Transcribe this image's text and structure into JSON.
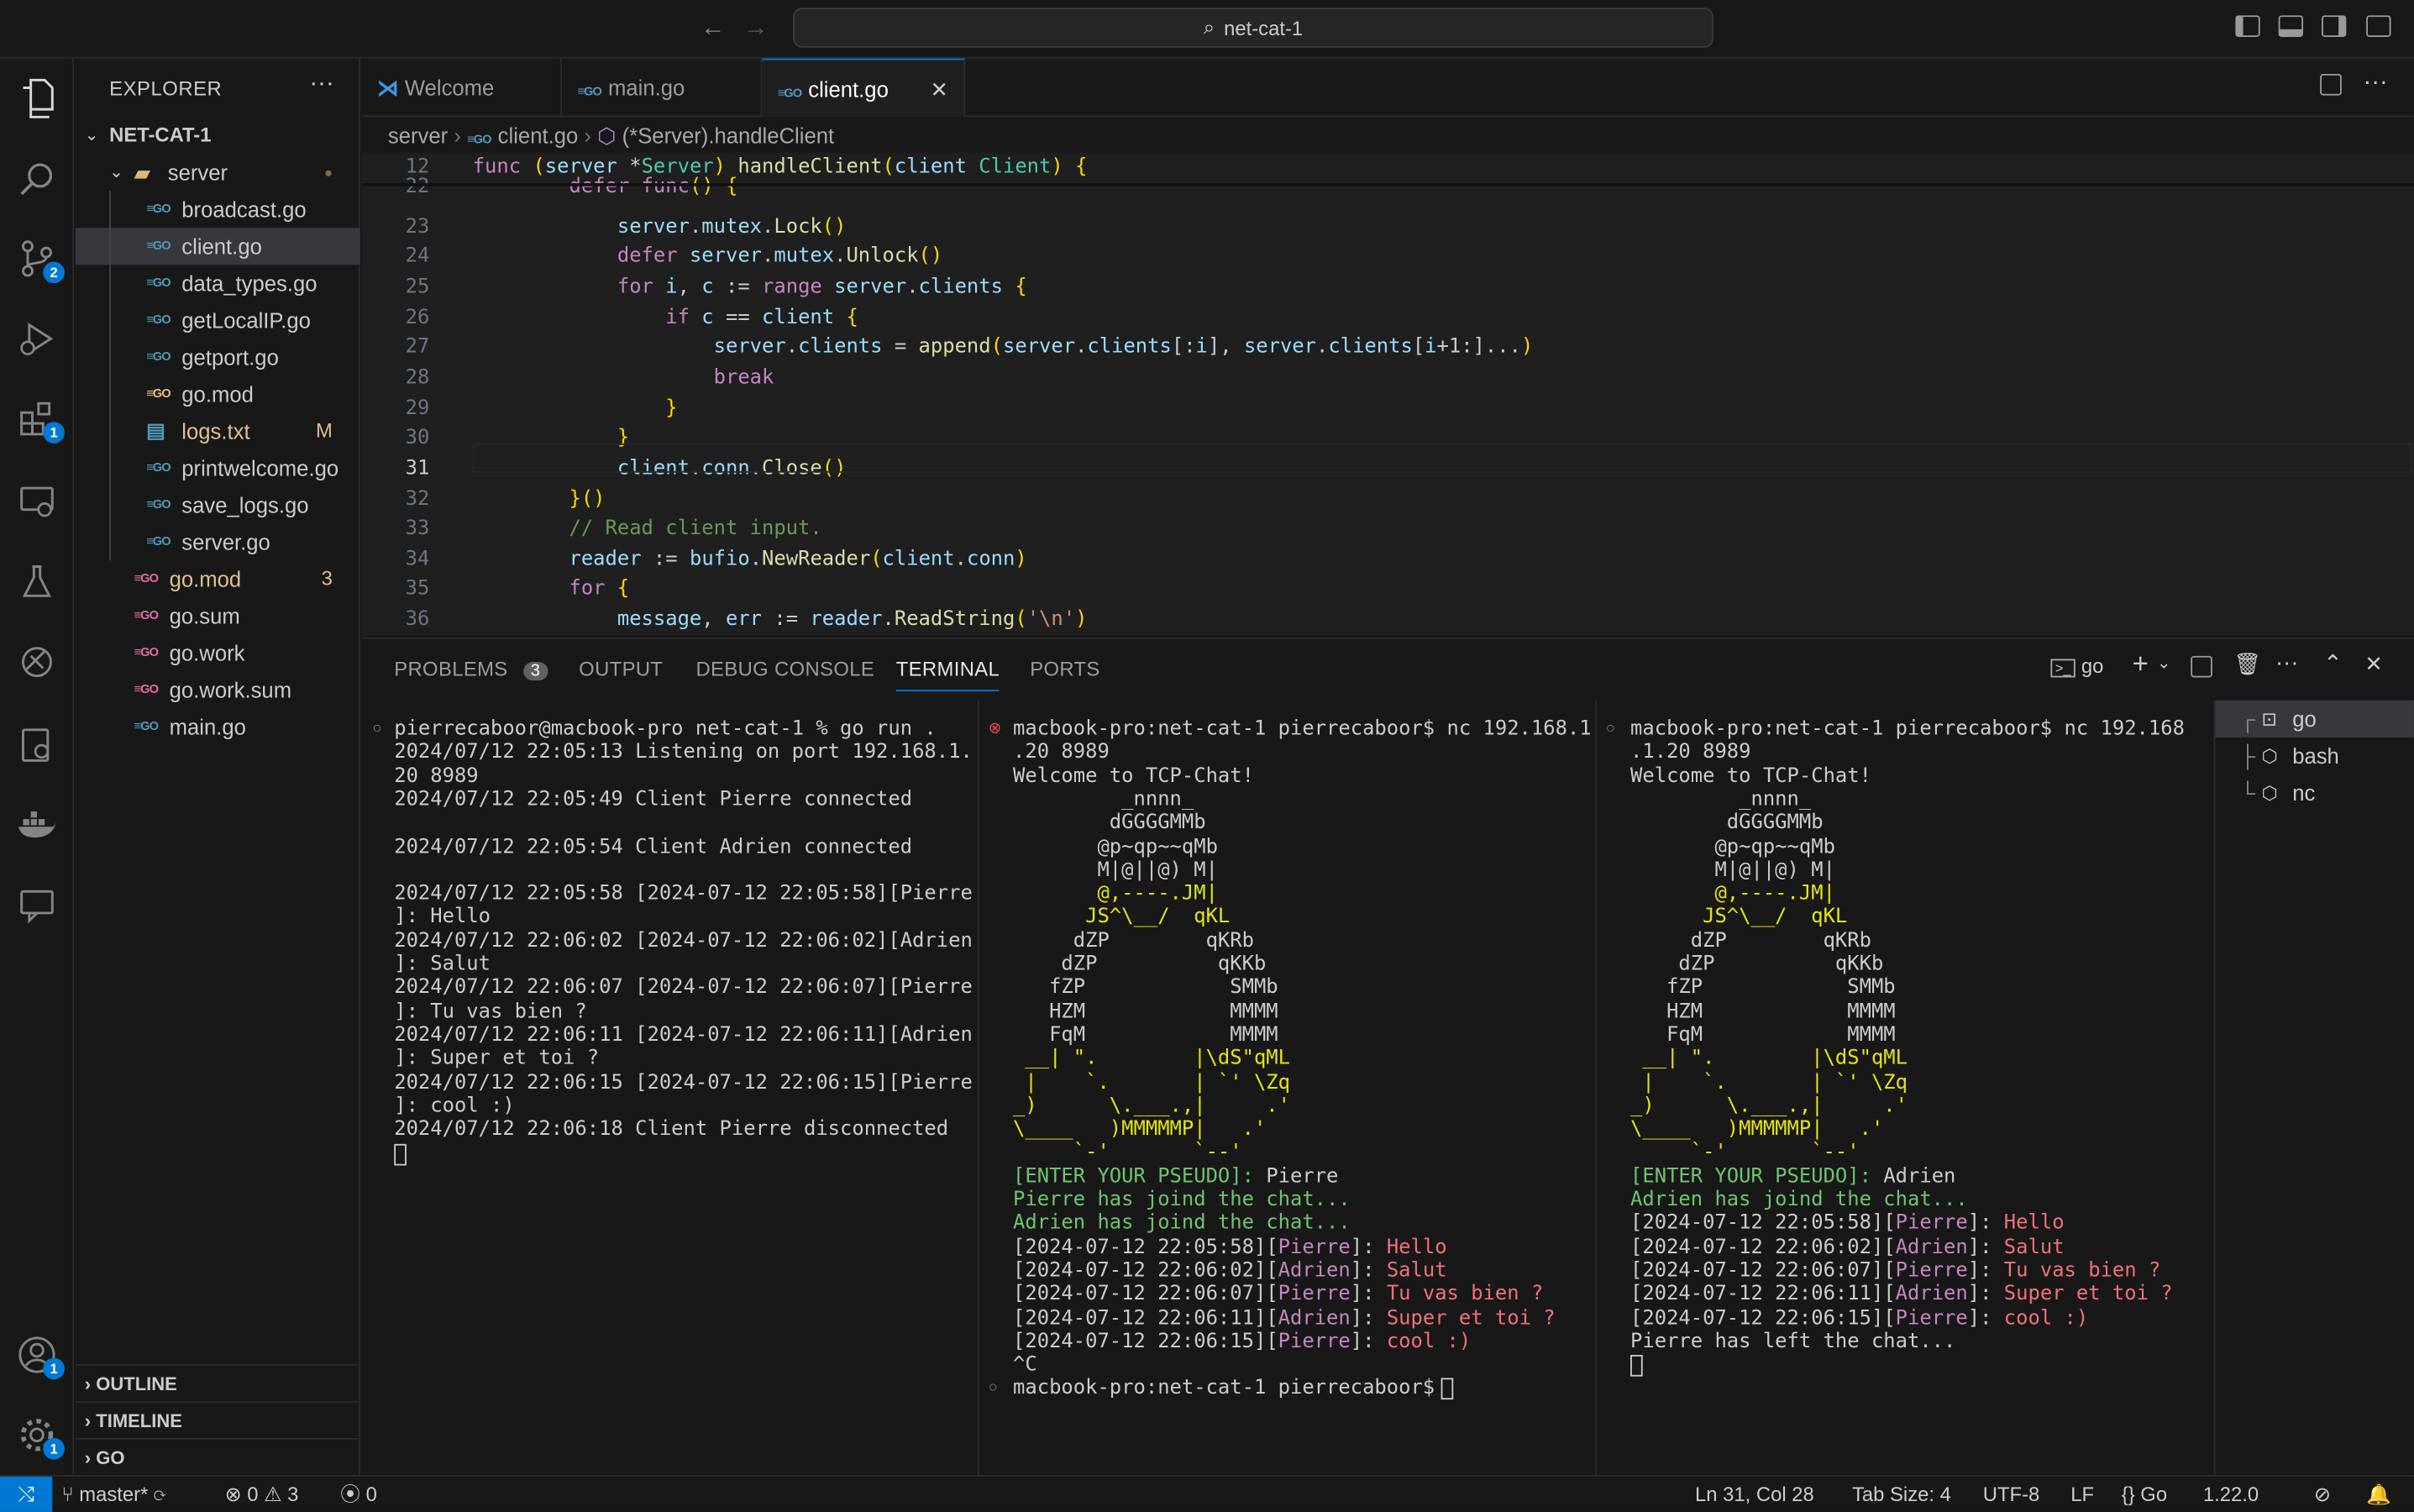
{
  "title": {
    "search": "net-cat-1"
  },
  "sidebar": {
    "title": "EXPLORER",
    "project": "NET-CAT-1",
    "tree": [
      {
        "name": "server",
        "type": "folder",
        "depth": 1
      },
      {
        "name": "broadcast.go",
        "type": "go",
        "depth": 2
      },
      {
        "name": "client.go",
        "type": "go",
        "depth": 2,
        "selected": true
      },
      {
        "name": "data_types.go",
        "type": "go",
        "depth": 2
      },
      {
        "name": "getLocalIP.go",
        "type": "go",
        "depth": 2
      },
      {
        "name": "getport.go",
        "type": "go",
        "depth": 2
      },
      {
        "name": "go.mod",
        "type": "mod",
        "depth": 2
      },
      {
        "name": "logs.txt",
        "type": "txt",
        "depth": 2,
        "badge": "M"
      },
      {
        "name": "printwelcome.go",
        "type": "go",
        "depth": 2
      },
      {
        "name": "save_logs.go",
        "type": "go",
        "depth": 2
      },
      {
        "name": "server.go",
        "type": "go",
        "depth": 2
      },
      {
        "name": "go.mod",
        "type": "mod",
        "depth": 1,
        "badge": "3",
        "modified": true
      },
      {
        "name": "go.sum",
        "type": "mod",
        "depth": 1
      },
      {
        "name": "go.work",
        "type": "mod",
        "depth": 1
      },
      {
        "name": "go.work.sum",
        "type": "mod",
        "depth": 1
      },
      {
        "name": "main.go",
        "type": "go",
        "depth": 1
      }
    ],
    "sections": [
      "OUTLINE",
      "TIMELINE",
      "GO"
    ]
  },
  "activity": {
    "scm_badge": "2",
    "ext_badge": "1",
    "account_badge": "1",
    "settings_badge": "1"
  },
  "tabs": [
    {
      "label": "Welcome"
    },
    {
      "label": "main.go"
    },
    {
      "label": "client.go",
      "active": true
    }
  ],
  "breadcrumb": {
    "folder": "server",
    "file": "client.go",
    "symbol": "(*Server).handleClient"
  },
  "editor": {
    "lines": [
      [
        "12",
        "func (server *Server) handleClient(client Client) {"
      ],
      [
        "22",
        "        defer func() {"
      ],
      [
        "23",
        "            server.mutex.Lock()"
      ],
      [
        "24",
        "            defer server.mutex.Unlock()"
      ],
      [
        "25",
        "            for i, c := range server.clients {"
      ],
      [
        "26",
        "                if c == client {"
      ],
      [
        "27",
        "                    server.clients = append(server.clients[:i], server.clients[i+1:]...)"
      ],
      [
        "28",
        "                    break"
      ],
      [
        "29",
        "                }"
      ],
      [
        "30",
        "            }"
      ],
      [
        "31",
        "            client.conn.Close()"
      ],
      [
        "32",
        "        }()"
      ],
      [
        "33",
        "        // Read client input."
      ],
      [
        "34",
        "        reader := bufio.NewReader(client.conn)"
      ],
      [
        "35",
        "        for {"
      ],
      [
        "36",
        "            message, err := reader.ReadString('\\n')"
      ]
    ]
  },
  "panel": {
    "tabs": [
      "PROBLEMS",
      "OUTPUT",
      "DEBUG CONSOLE",
      "TERMINAL",
      "PORTS"
    ],
    "problems_count": "3",
    "active": "TERMINAL",
    "shell": "go",
    "terminals": [
      "go",
      "bash",
      "nc"
    ]
  },
  "term1": [
    "pierrecaboor@macbook-pro net-cat-1 % go run .",
    "2024/07/12 22:05:13 Listening on port 192.168.1.",
    "20 8989",
    "2024/07/12 22:05:49 Client Pierre connected",
    "",
    "2024/07/12 22:05:54 Client Adrien connected",
    "",
    "2024/07/12 22:05:58 [2024-07-12 22:05:58][Pierre",
    "]: Hello",
    "2024/07/12 22:06:02 [2024-07-12 22:06:02][Adrien",
    "]: Salut",
    "2024/07/12 22:06:07 [2024-07-12 22:06:07][Pierre",
    "]: Tu vas bien ?",
    "2024/07/12 22:06:11 [2024-07-12 22:06:11][Adrien",
    "]: Super et toi ?",
    "2024/07/12 22:06:15 [2024-07-12 22:06:15][Pierre",
    "]: cool :)",
    "2024/07/12 22:06:18 Client Pierre disconnected"
  ],
  "term2": {
    "prompt": "macbook-pro:net-cat-1 pierrecaboor$ nc 192.168.1",
    "prompt2": ".20 8989",
    "welcome": "Welcome to TCP-Chat!",
    "pseudo_label": "[ENTER YOUR PSEUDO]:",
    "pseudo": "Pierre",
    "joins": [
      "Pierre has joind the chat...",
      "Adrien has joind the chat..."
    ],
    "messages": [
      [
        "[2024-07-12 22:05:58]",
        "Pierre",
        "Hello"
      ],
      [
        "[2024-07-12 22:06:02]",
        "Adrien",
        "Salut"
      ],
      [
        "[2024-07-12 22:06:07]",
        "Pierre",
        "Tu vas bien ?"
      ],
      [
        "[2024-07-12 22:06:11]",
        "Adrien",
        "Super et toi ?"
      ],
      [
        "[2024-07-12 22:06:15]",
        "Pierre",
        "cool :)"
      ]
    ],
    "ctrl": "^C",
    "final": "macbook-pro:net-cat-1 pierrecaboor$ "
  },
  "term3": {
    "prompt": "macbook-pro:net-cat-1 pierrecaboor$ nc 192.168",
    "prompt2": ".1.20 8989",
    "welcome": "Welcome to TCP-Chat!",
    "pseudo_label": "[ENTER YOUR PSEUDO]:",
    "pseudo": "Adrien",
    "joins": [
      "Adrien has joind the chat..."
    ],
    "messages": [
      [
        "[2024-07-12 22:05:58]",
        "Pierre",
        "Hello"
      ],
      [
        "[2024-07-12 22:06:02]",
        "Adrien",
        "Salut"
      ],
      [
        "[2024-07-12 22:06:07]",
        "Pierre",
        "Tu vas bien ?"
      ],
      [
        "[2024-07-12 22:06:11]",
        "Adrien",
        "Super et toi ?"
      ],
      [
        "[2024-07-12 22:06:15]",
        "Pierre",
        "cool :)"
      ]
    ],
    "left": "Pierre has left the chat..."
  },
  "penguin": [
    "         _nnnn_",
    "        dGGGGMMb",
    "       @p~qp~~qMb",
    "       M|@||@) M|",
    "       @,----.JM|",
    "      JS^\\__/  qKL",
    "     dZP        qKRb",
    "    dZP          qKKb",
    "   fZP            SMMb",
    "   HZM            MMMM",
    "   FqM            MMMM",
    " __| \".        |\\dS\"qML",
    " |    `.       | `' \\Zq",
    "_)      \\.___.,|     .'",
    "\\____   )MMMMMP|   .'",
    "     `-'       `--'"
  ],
  "status": {
    "branch": "master*",
    "errors": "0",
    "warnings": "3",
    "ports": "0",
    "position": "Ln 31, Col 28",
    "tabsize": "Tab Size: 4",
    "encoding": "UTF-8",
    "eol": "LF",
    "lang": "Go",
    "version": "1.22.0"
  }
}
